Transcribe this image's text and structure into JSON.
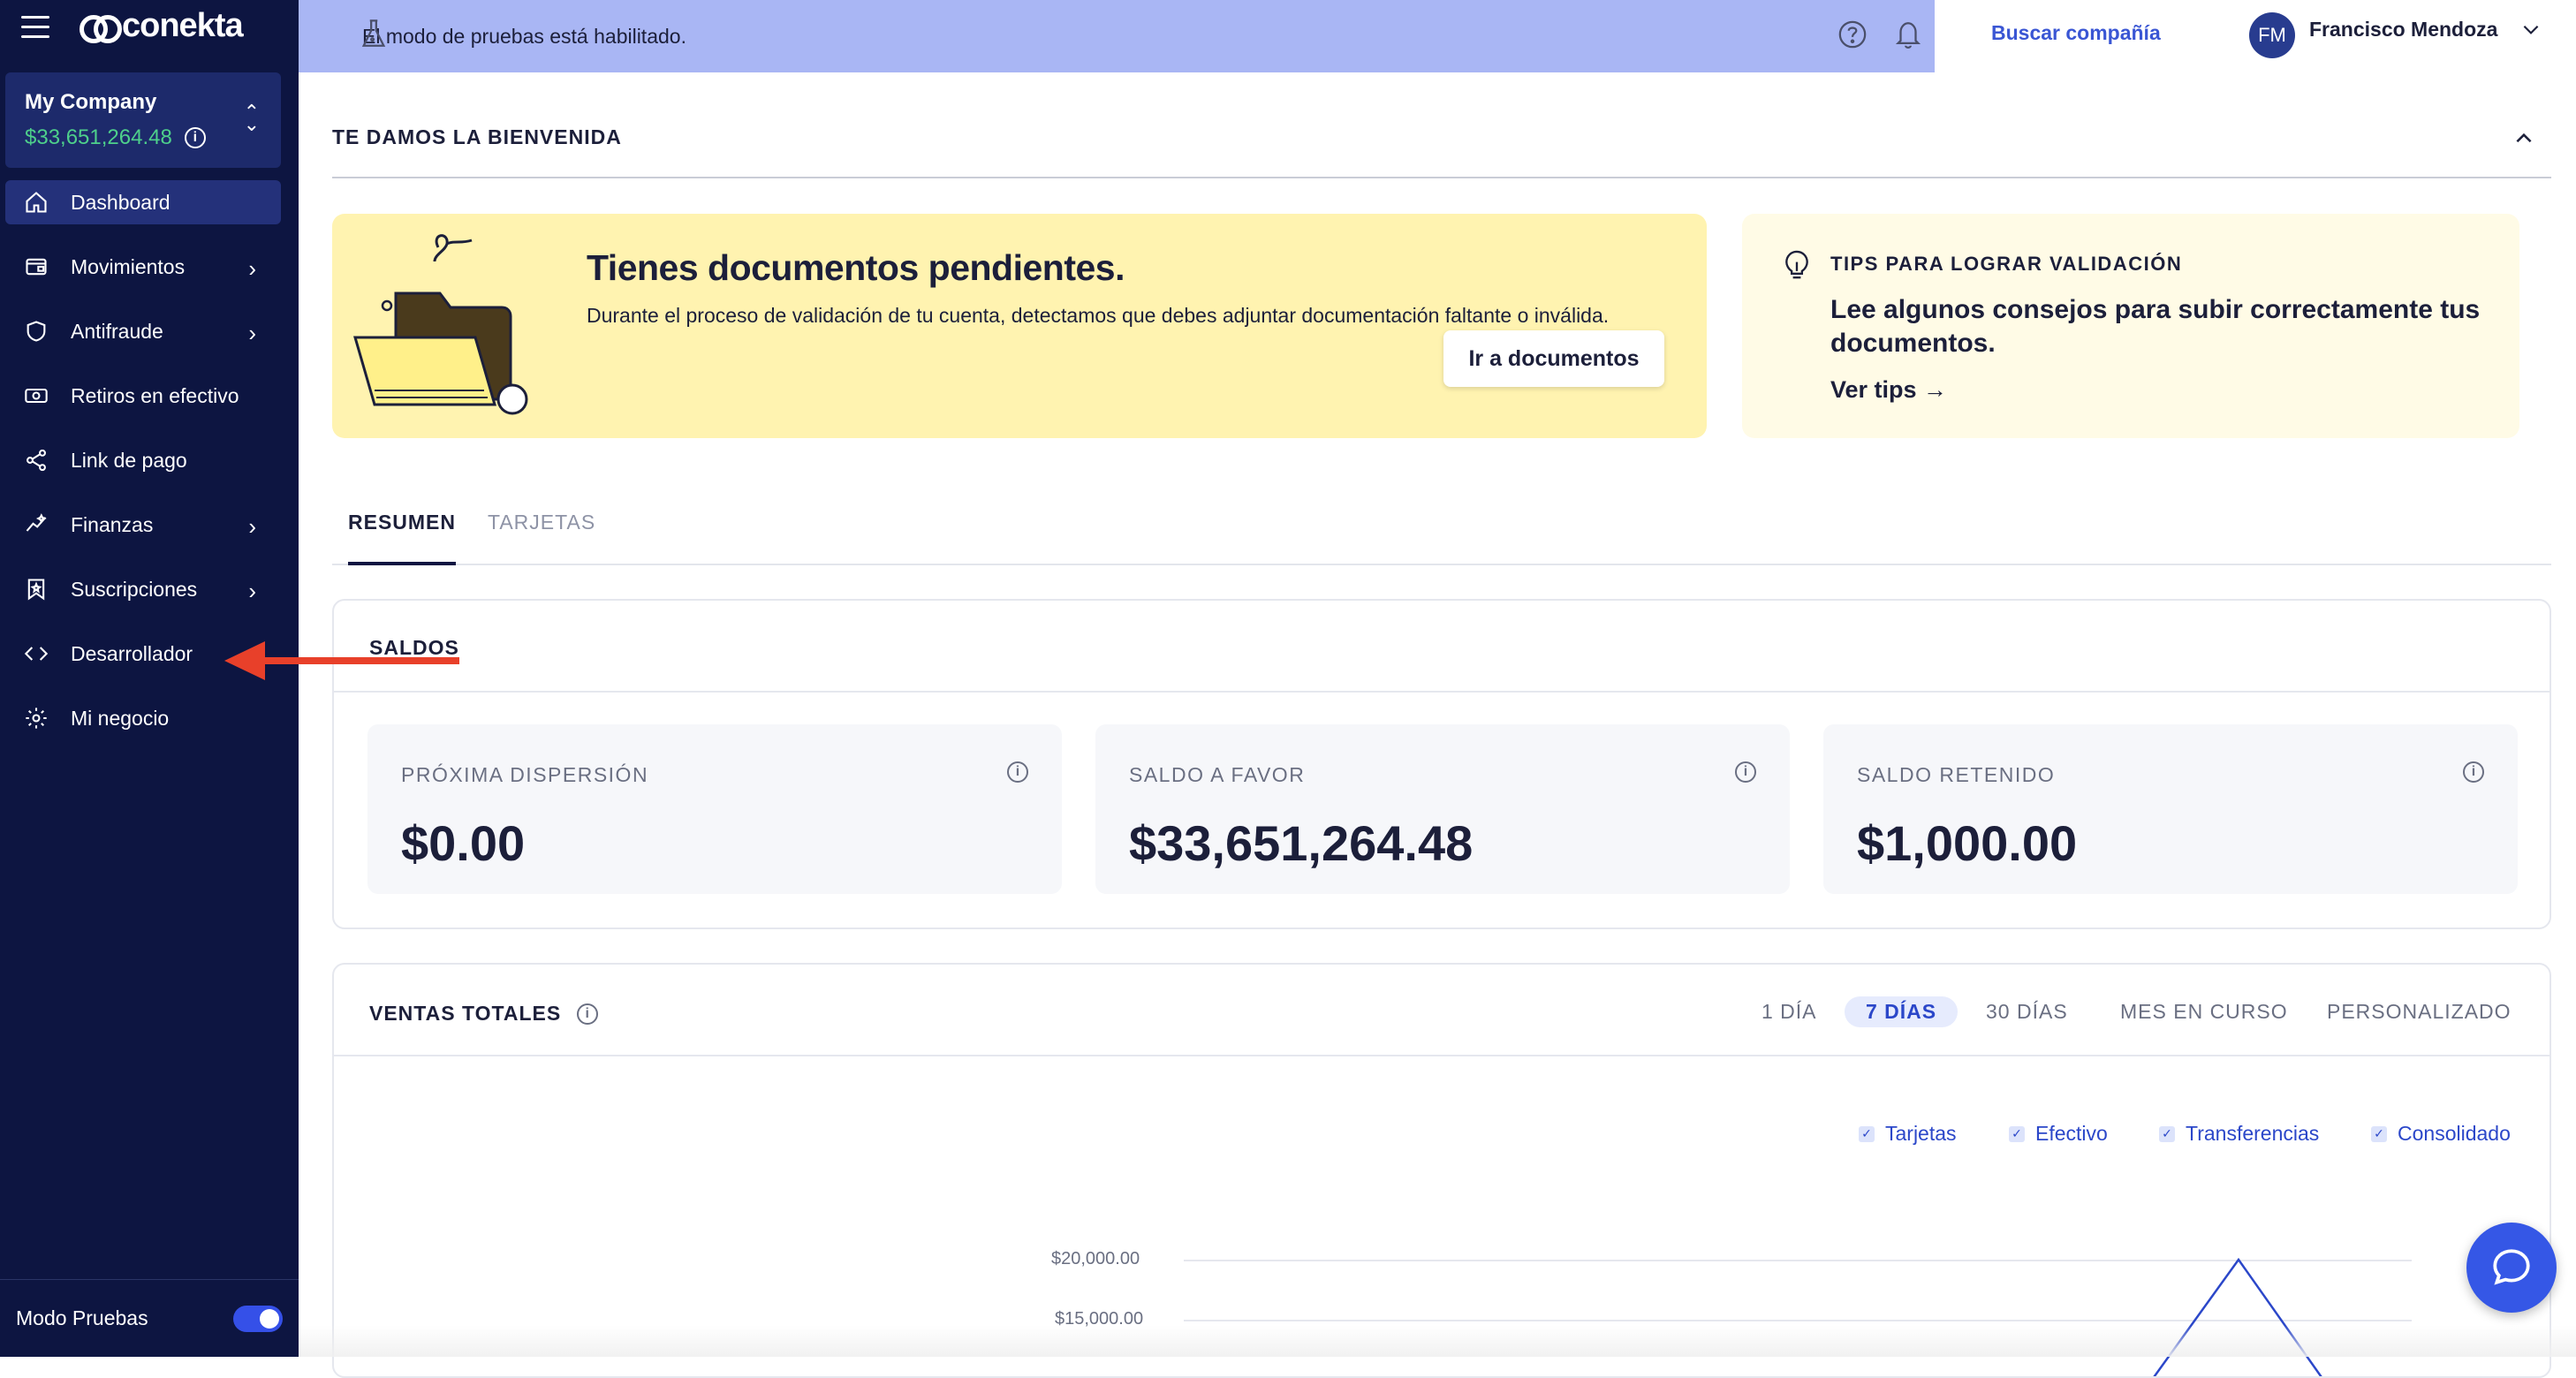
{
  "brand": {
    "name": "conekta"
  },
  "company": {
    "name": "My Company",
    "balance": "$33,651,264.48"
  },
  "nav": {
    "items": [
      {
        "label": "Dashboard",
        "icon": "home-icon"
      },
      {
        "label": "Movimientos",
        "icon": "wallet-icon"
      },
      {
        "label": "Antifraude",
        "icon": "shield-icon"
      },
      {
        "label": "Retiros en efectivo",
        "icon": "cash-icon"
      },
      {
        "label": "Link de pago",
        "icon": "share-icon"
      },
      {
        "label": "Finanzas",
        "icon": "chart-sparkle-icon"
      },
      {
        "label": "Suscripciones",
        "icon": "bookmark-star-icon"
      },
      {
        "label": "Desarrollador",
        "icon": "code-icon"
      },
      {
        "label": "Mi negocio",
        "icon": "gear-icon"
      }
    ]
  },
  "test_mode": {
    "label": "Modo Pruebas",
    "enabled": true
  },
  "topbar": {
    "notice": "El modo de pruebas está habilitado.",
    "search_company": "Buscar compañía",
    "user_initials": "FM",
    "user_name": "Francisco Mendoza"
  },
  "welcome": {
    "title": "TE DAMOS LA BIENVENIDA"
  },
  "pending": {
    "title": "Tienes documentos pendientes.",
    "description": "Durante el proceso de validación de tu cuenta, detectamos que debes adjuntar documentación faltante o inválida.",
    "button": "Ir a documentos"
  },
  "tips": {
    "caption": "TIPS PARA LOGRAR VALIDACIÓN",
    "headline": "Lee algunos consejos para subir correctamente tus documentos.",
    "link": "Ver tips →"
  },
  "tabs": [
    "RESUMEN",
    "TARJETAS"
  ],
  "saldos": {
    "title": "SALDOS",
    "boxes": [
      {
        "label": "PRÓXIMA DISPERSIÓN",
        "value": "$0.00"
      },
      {
        "label": "SALDO A FAVOR",
        "value": "$33,651,264.48"
      },
      {
        "label": "SALDO RETENIDO",
        "value": "$1,000.00"
      }
    ]
  },
  "ventas": {
    "title": "VENTAS TOTALES",
    "ranges": [
      "1 DÍA",
      "7 DÍAS",
      "30 DÍAS",
      "MES EN CURSO",
      "PERSONALIZADO"
    ],
    "active_range": "7 DÍAS",
    "legend": [
      "Tarjetas",
      "Efectivo",
      "Transferencias",
      "Consolidado"
    ],
    "y_ticks": [
      "$20,000.00",
      "$15,000.00"
    ]
  },
  "colors": {
    "sidebar": "#0d1541",
    "topbar": "#a9b6f4",
    "accent": "#3550e8",
    "balance_green": "#4ed08b",
    "pending_bg": "#fff3b0",
    "annotation_arrow": "#e8402a"
  }
}
